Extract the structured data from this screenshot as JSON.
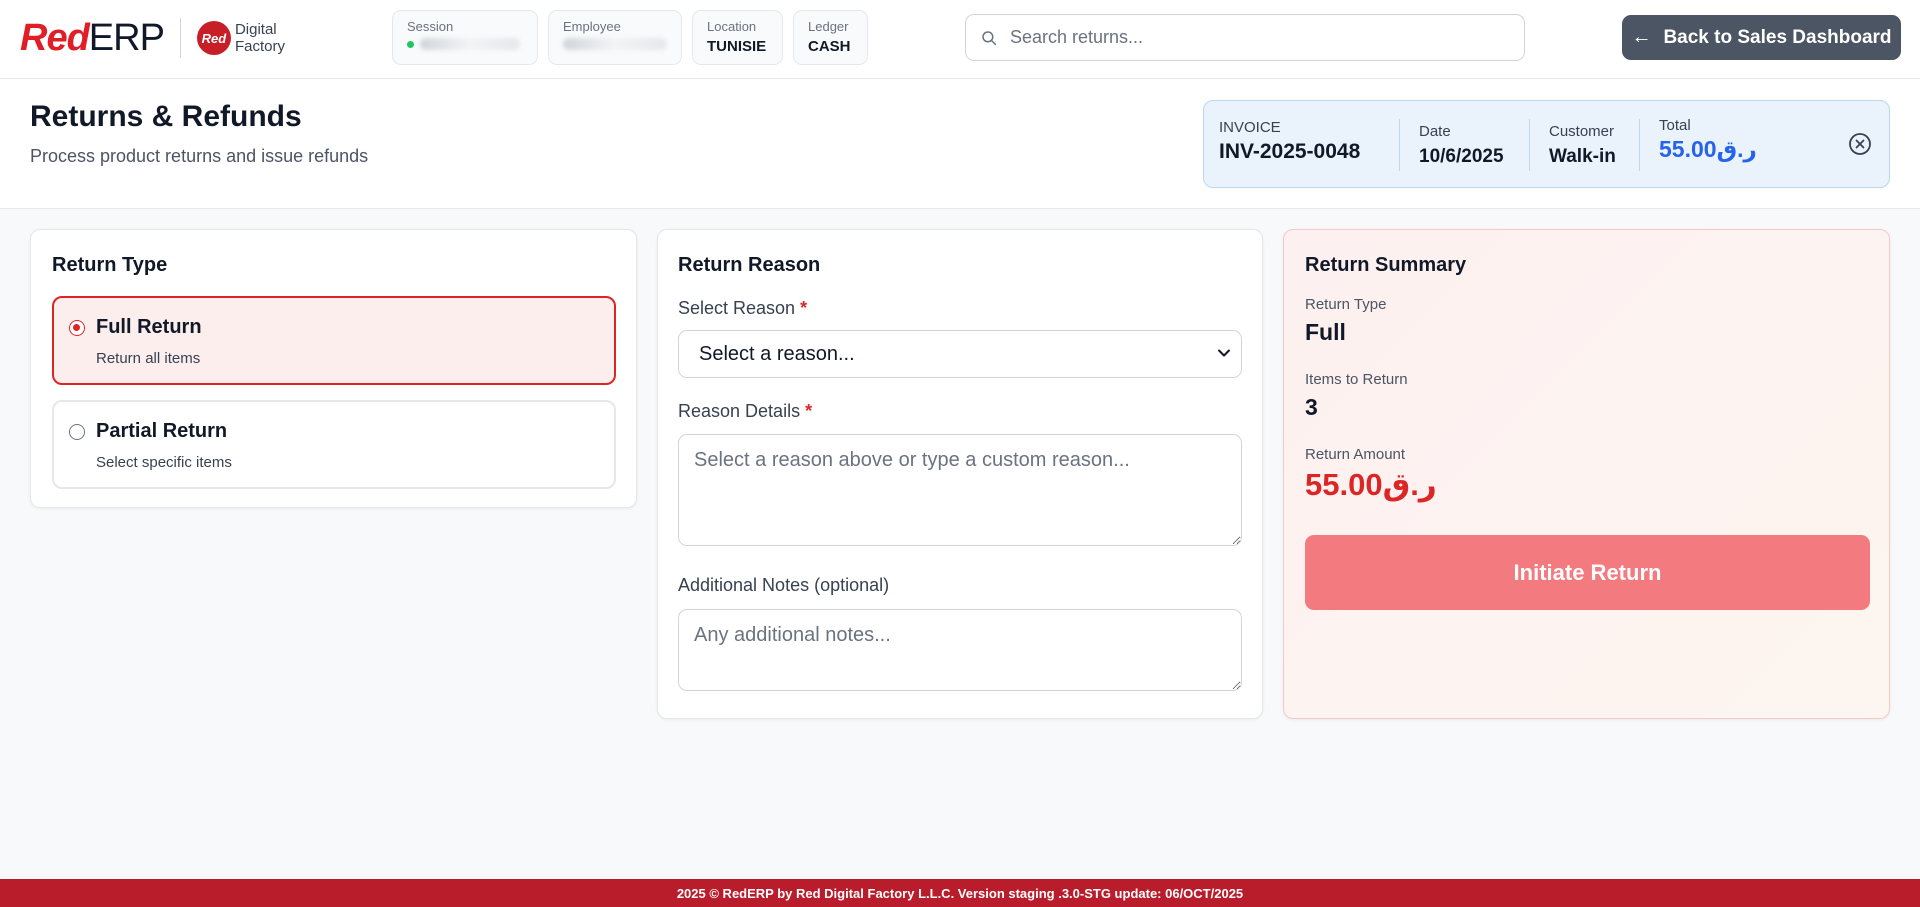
{
  "brand": {
    "logo_red": "Red",
    "logo_erp": "ERP",
    "partner_badge": "Red",
    "partner_line1": "Digital",
    "partner_line2": "Factory"
  },
  "header": {
    "chips": [
      {
        "label": "Session",
        "value": ""
      },
      {
        "label": "Employee",
        "value": ""
      },
      {
        "label": "Location",
        "value": "TUNISIE"
      },
      {
        "label": "Ledger",
        "value": "CASH"
      }
    ],
    "search": {
      "placeholder": "Search returns...",
      "value": ""
    },
    "back_button": "Back to Sales Dashboard"
  },
  "page": {
    "title": "Returns & Refunds",
    "subtitle": "Process product returns and issue refunds"
  },
  "invoice": {
    "label": "INVOICE",
    "number": "INV-2025-0048",
    "date_label": "Date",
    "date": "10/6/2025",
    "customer_label": "Customer",
    "customer": "Walk-in",
    "total_label": "Total",
    "total": "55.00ر.ق"
  },
  "return_type": {
    "title": "Return Type",
    "options": [
      {
        "title": "Full Return",
        "desc": "Return all items",
        "selected": true
      },
      {
        "title": "Partial Return",
        "desc": "Select specific items",
        "selected": false
      }
    ]
  },
  "return_reason": {
    "title": "Return Reason",
    "select_label": "Select Reason",
    "select_value": "Select a reason...",
    "details_label": "Reason Details",
    "details_placeholder": "Select a reason above or type a custom reason...",
    "notes_label": "Additional Notes (optional)",
    "notes_placeholder": "Any additional notes...",
    "required_mark": "*"
  },
  "summary": {
    "title": "Return Summary",
    "type_label": "Return Type",
    "type_value": "Full",
    "items_label": "Items to Return",
    "items_value": "3",
    "amount_label": "Return Amount",
    "amount_value": "55.00ر.ق",
    "button": "Initiate Return"
  },
  "footer": {
    "text": "2025 © RedERP by Red Digital Factory L.L.C. Version staging .3.0-STG update: 06/OCT/2025"
  },
  "colors": {
    "brand_red": "#e11d26",
    "footer_red": "#b91c2a",
    "accent_blue": "#2563eb",
    "button_gray": "#4b5563",
    "initiate_button": "#f37a7f"
  }
}
